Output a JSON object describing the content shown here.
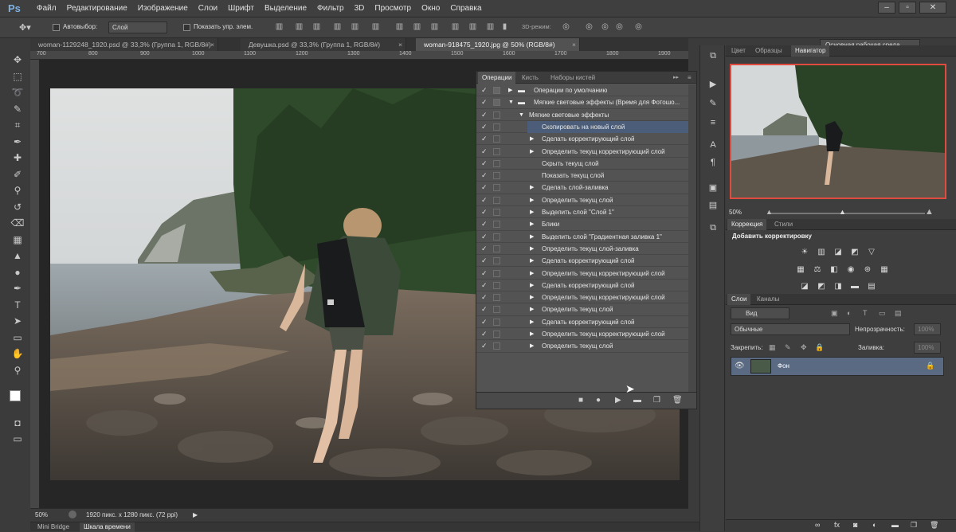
{
  "app": {
    "logo": "Ps"
  },
  "menu": [
    "Файл",
    "Редактирование",
    "Изображение",
    "Слои",
    "Шрифт",
    "Выделение",
    "Фильтр",
    "3D",
    "Просмотр",
    "Окно",
    "Справка"
  ],
  "window_controls": {
    "minimize": "–",
    "restore": "▫",
    "close": "✕"
  },
  "options_bar": {
    "autoselect_label": "Автовыбор:",
    "autoselect_value": "Слой",
    "show_transform_label": "Показать упр. элем.",
    "mode_3d_label": "3D-режим:",
    "workspace": "Основная рабочая среда"
  },
  "doc_tabs": [
    {
      "label": "woman-1129248_1920.psd @ 33,3% (Группа 1, RGB/8#)",
      "close": "×"
    },
    {
      "label": "Девушка.psd @ 33,3% (Группа 1, RGB/8#)",
      "close": "×"
    },
    {
      "label": "woman-918475_1920.jpg @ 50% (RGB/8#)",
      "close": "×"
    }
  ],
  "ruler_ticks": [
    "700",
    "800",
    "900",
    "1000",
    "1100",
    "1200",
    "1300",
    "1400",
    "1500",
    "1600",
    "1700",
    "1800",
    "1900"
  ],
  "actions_panel": {
    "tabs": [
      "Операции",
      "Кисть",
      "Наборы кистей"
    ],
    "collapse_icon": "▸▸",
    "menu_icon": "≡",
    "rows": [
      {
        "label": "Операции по умолчанию",
        "level": 0,
        "arrow": "▶",
        "folder": true,
        "sel": false
      },
      {
        "label": "Мягкие световые эффекты (Время для Фотошо...",
        "level": 0,
        "arrow": "▼",
        "folder": true,
        "sel": false
      },
      {
        "label": "Мягкие световые эффекты",
        "level": 1,
        "arrow": "▼",
        "folder": false,
        "sel": false
      },
      {
        "label": "Скопировать на новый слой",
        "level": 2,
        "arrow": "",
        "folder": false,
        "sel": true
      },
      {
        "label": "Сделать корректирующий слой",
        "level": 2,
        "arrow": "▶",
        "folder": false,
        "sel": false
      },
      {
        "label": "Определить текущ корректирующий слой",
        "level": 2,
        "arrow": "▶",
        "folder": false,
        "sel": false
      },
      {
        "label": "Скрыть текущ слой",
        "level": 2,
        "arrow": "",
        "folder": false,
        "sel": false
      },
      {
        "label": "Показать текущ слой",
        "level": 2,
        "arrow": "",
        "folder": false,
        "sel": false
      },
      {
        "label": "Сделать слой-заливка",
        "level": 2,
        "arrow": "▶",
        "folder": false,
        "sel": false
      },
      {
        "label": "Определить текущ слой",
        "level": 2,
        "arrow": "▶",
        "folder": false,
        "sel": false
      },
      {
        "label": "Выделить слой \"Слой 1\"",
        "level": 2,
        "arrow": "▶",
        "folder": false,
        "sel": false
      },
      {
        "label": "Блики",
        "level": 2,
        "arrow": "▶",
        "folder": false,
        "sel": false
      },
      {
        "label": "Выделить слой \"Градиентная заливка 1\"",
        "level": 2,
        "arrow": "▶",
        "folder": false,
        "sel": false
      },
      {
        "label": "Определить текущ слой-заливка",
        "level": 2,
        "arrow": "▶",
        "folder": false,
        "sel": false
      },
      {
        "label": "Сделать корректирующий слой",
        "level": 2,
        "arrow": "▶",
        "folder": false,
        "sel": false
      },
      {
        "label": "Определить текущ корректирующий слой",
        "level": 2,
        "arrow": "▶",
        "folder": false,
        "sel": false
      },
      {
        "label": "Сделать корректирующий слой",
        "level": 2,
        "arrow": "▶",
        "folder": false,
        "sel": false
      },
      {
        "label": "Определить текущ корректирующий слой",
        "level": 2,
        "arrow": "▶",
        "folder": false,
        "sel": false
      },
      {
        "label": "Определить текущ слой",
        "level": 2,
        "arrow": "▶",
        "folder": false,
        "sel": false
      },
      {
        "label": "Сделать корректирующий слой",
        "level": 2,
        "arrow": "▶",
        "folder": false,
        "sel": false
      },
      {
        "label": "Определить текущ корректирующий слой",
        "level": 2,
        "arrow": "▶",
        "folder": false,
        "sel": false
      },
      {
        "label": "Определить текущ слой",
        "level": 2,
        "arrow": "▶",
        "folder": false,
        "sel": false
      }
    ],
    "check_mark": "✓"
  },
  "right_panels": {
    "top_tabs": [
      "Цвет",
      "Образцы",
      "Навигатор"
    ],
    "nav_zoom": "50%",
    "adj_tabs": [
      "Коррекция",
      "Стили"
    ],
    "adj_title": "Добавить корректировку",
    "layers_tabs": [
      "Слои",
      "Каналы"
    ],
    "filter_kind": "Вид",
    "blend_mode": "Обычные",
    "opacity_label": "Непрозрачность:",
    "opacity_value": "100%",
    "lock_label": "Закрепить:",
    "fill_label": "Заливка:",
    "fill_value": "100%",
    "layer_name": "Фон"
  },
  "status": {
    "zoom": "50%",
    "doc_info": "1920 пикс. x 1280 пикс. (72 ppi)"
  },
  "bottom_tabs": [
    "Mini Bridge",
    "Шкала времени"
  ],
  "colors": {
    "accent_red": "#e04b3f",
    "selection_blue": "#4b5d78",
    "ps_blue": "#7fb2e0"
  }
}
